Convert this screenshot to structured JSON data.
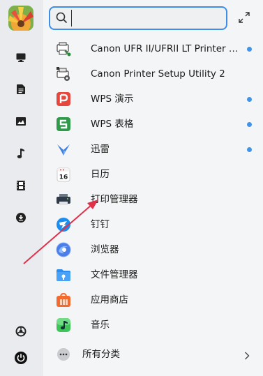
{
  "search": {
    "value": "",
    "placeholder": ""
  },
  "apps": [
    {
      "label": "Canon UFR II/UFRII LT Printer S...",
      "icon": "canon-printer-driver-icon",
      "new": true
    },
    {
      "label": "Canon Printer Setup Utility 2",
      "icon": "canon-setup-utility-icon",
      "new": false
    },
    {
      "label": "WPS 演示",
      "icon": "wps-presentation-icon",
      "new": true
    },
    {
      "label": "WPS 表格",
      "icon": "wps-spreadsheet-icon",
      "new": true
    },
    {
      "label": "迅雷",
      "icon": "thunder-icon",
      "new": true
    },
    {
      "label": "日历",
      "icon": "calendar-icon",
      "new": false,
      "calendar_day": "16"
    },
    {
      "label": "打印管理器",
      "icon": "printer-manager-icon",
      "new": false
    },
    {
      "label": "钉钉",
      "icon": "dingtalk-icon",
      "new": false
    },
    {
      "label": "浏览器",
      "icon": "browser-icon",
      "new": false
    },
    {
      "label": "文件管理器",
      "icon": "file-manager-icon",
      "new": false
    },
    {
      "label": "应用商店",
      "icon": "app-store-icon",
      "new": false
    },
    {
      "label": "音乐",
      "icon": "music-icon",
      "new": false
    }
  ],
  "footer": {
    "all_categories_label": "所有分类"
  },
  "colors": {
    "accent": "#3c8ee6",
    "new_dot": "#3f95e8",
    "annotation_arrow": "#e0304a"
  }
}
